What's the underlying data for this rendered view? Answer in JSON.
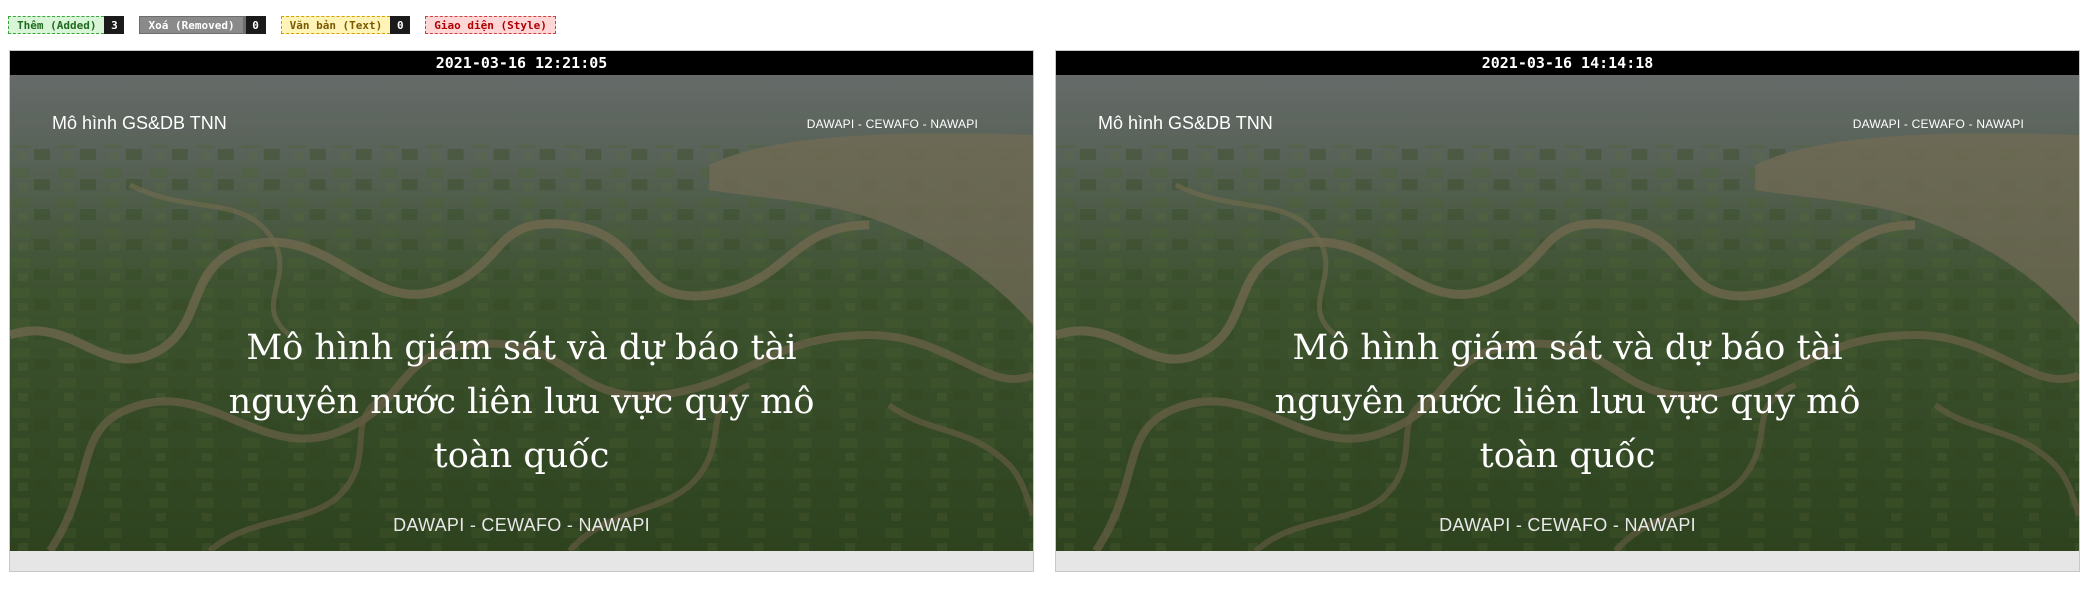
{
  "legend": {
    "added": {
      "label": "Thêm (Added)",
      "count": "3"
    },
    "removed": {
      "label": "Xoá (Removed)",
      "count": "0"
    },
    "text": {
      "label": "Văn bản (Text)",
      "count": "0"
    },
    "style": {
      "label": "Giao diện (Style)"
    }
  },
  "panels": [
    {
      "timestamp": "2021-03-16 12:21:05",
      "site_title": "Mô hình GS&DB TNN",
      "nav_text": "DAWAPI - CEWAFO - NAWAPI",
      "hero_heading": "Mô hình giám sát và dự báo tài nguyên nước liên lưu vực quy mô toàn quốc",
      "hero_sub": "DAWAPI - CEWAFO - NAWAPI"
    },
    {
      "timestamp": "2021-03-16 14:14:18",
      "site_title": "Mô hình GS&DB TNN",
      "nav_text": "DAWAPI - CEWAFO - NAWAPI",
      "hero_heading": "Mô hình giám sát và dự báo tài nguyên nước liên lưu vực quy mô toàn quốc",
      "hero_sub": "DAWAPI - CEWAFO - NAWAPI"
    }
  ],
  "colors": {
    "added": "#3aa53a",
    "removed": "#8a8a8a",
    "text": "#d4a000",
    "style": "#d04040",
    "timestamp_bar": "#000000"
  }
}
